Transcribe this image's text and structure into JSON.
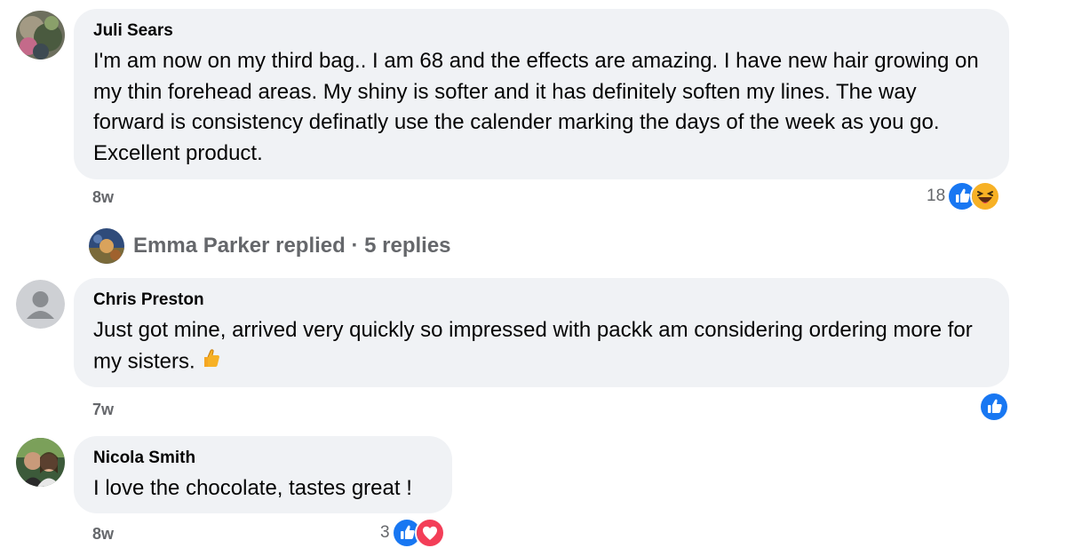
{
  "comments": [
    {
      "author": "Juli Sears",
      "text": "I'm am now on my third bag.. I am 68 and the effects are amazing. I have new hair growing on my thin forehead areas. My shiny is softer and it has definitely soften my lines. The way forward is consistency definatly use the calender marking the days of the week as you go. Excellent product.",
      "time": "8w",
      "reaction_count": "18",
      "reactions": [
        "like-icon",
        "haha-icon"
      ]
    },
    {
      "author": "Chris Preston",
      "text": "Just got mine, arrived very quickly so impressed with packk am considering ordering more for my sisters.",
      "emoji": "thumbs-up-emoji",
      "time": "7w",
      "reaction_count": "",
      "reactions": [
        "like-icon"
      ]
    },
    {
      "author": "Nicola Smith",
      "text": "I love the chocolate, tastes great !",
      "time": "8w",
      "reaction_count": "3",
      "reactions": [
        "like-icon",
        "love-icon"
      ]
    }
  ],
  "replies": {
    "summary": "Emma Parker replied · 5 replies"
  },
  "colors": {
    "bubble": "#f0f2f5",
    "secondary_text": "#65676b",
    "like_blue": "#1877f2",
    "love_red": "#f33e58",
    "haha_yellow": "#f7b125"
  }
}
